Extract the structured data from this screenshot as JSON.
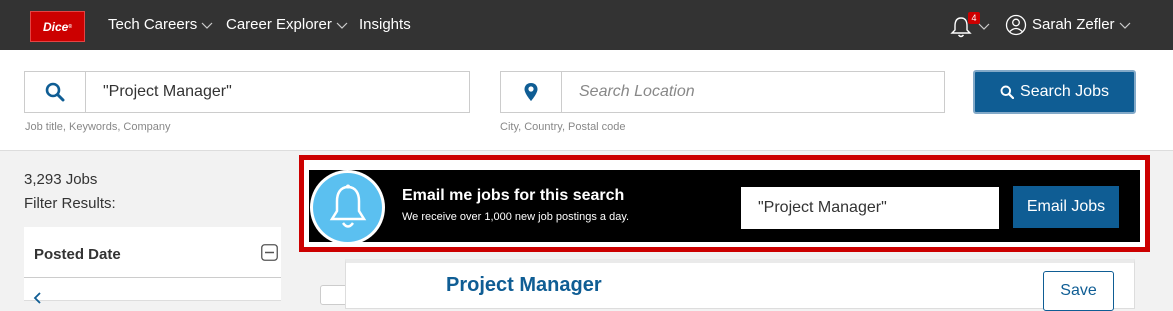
{
  "nav": {
    "logo_text": "Dice",
    "logo_mark": "®",
    "items": [
      {
        "label": "Tech Careers",
        "has_dropdown": true
      },
      {
        "label": "Career Explorer",
        "has_dropdown": true
      },
      {
        "label": "Insights",
        "has_dropdown": false
      }
    ],
    "notification_count": "4",
    "user_name": "Sarah Zefler",
    "colors": {
      "bar": "#333333",
      "brand": "#cc0000"
    }
  },
  "search": {
    "keyword_value": "\"Project Manager\"",
    "keyword_helper": "Job title, Keywords, Company",
    "location_placeholder": "Search Location",
    "location_helper": "City, Country, Postal code",
    "button_label": "Search Jobs",
    "accent": "#0f5d94"
  },
  "sidebar": {
    "jobs_count": "3,293 Jobs",
    "filter_label": "Filter Results:",
    "filters": [
      {
        "title": "Posted Date",
        "expanded": true
      }
    ]
  },
  "alert": {
    "title": "Email me jobs for this search",
    "subtitle": "We receive over 1,000 new job postings a day.",
    "input_value": "\"Project Manager\"",
    "button_label": "Email Jobs",
    "highlight_color": "#cc0000",
    "icon_color": "#5bc0f0"
  },
  "results": [
    {
      "title": "Project Manager",
      "save_label": "Save"
    }
  ]
}
